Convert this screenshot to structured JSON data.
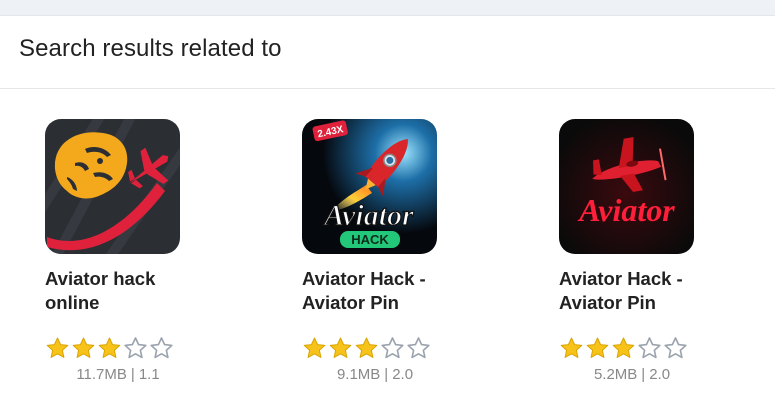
{
  "header": {
    "title": "Search results related to"
  },
  "colors": {
    "star_filled": "#f7c31a",
    "star_empty": "#9aa3ad",
    "name_text": "#222222",
    "meta_text": "#888888"
  },
  "apps": [
    {
      "name": "Aviator hack online",
      "rating": 3,
      "max_rating": 5,
      "size": "11.7MB",
      "version": "1.1",
      "icon": "lion-plane-logo-icon"
    },
    {
      "name": "Aviator Hack - Aviator Pin",
      "rating": 3,
      "max_rating": 5,
      "size": "9.1MB",
      "version": "2.0",
      "icon": "rocket-aviator-hack-logo-icon",
      "icon_text": {
        "badge": "2.43X",
        "word": "Aviator",
        "tag": "HACK"
      }
    },
    {
      "name": "Aviator Hack - Aviator Pin",
      "rating": 3,
      "max_rating": 5,
      "size": "5.2MB",
      "version": "2.0",
      "icon": "red-plane-aviator-logo-icon",
      "icon_text": {
        "word": "Aviator"
      }
    }
  ]
}
